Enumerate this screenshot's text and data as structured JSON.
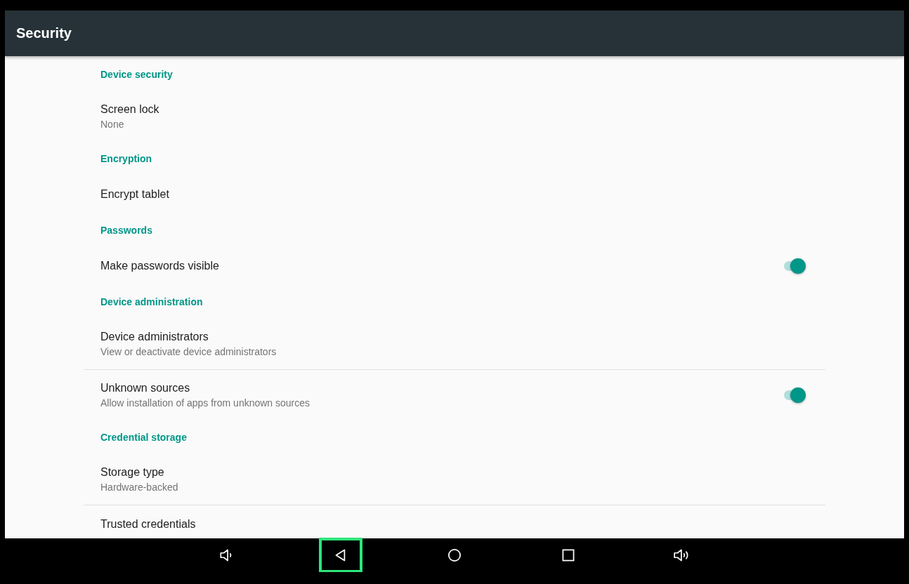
{
  "app_bar": {
    "title": "Security"
  },
  "sections": [
    {
      "header": "Device security",
      "items": [
        {
          "kind": "text",
          "title": "Screen lock",
          "summary": "None"
        }
      ]
    },
    {
      "header": "Encryption",
      "items": [
        {
          "kind": "text",
          "title": "Encrypt tablet"
        }
      ]
    },
    {
      "header": "Passwords",
      "items": [
        {
          "kind": "switch",
          "title": "Make passwords visible",
          "on": true
        }
      ]
    },
    {
      "header": "Device administration",
      "items": [
        {
          "kind": "text",
          "title": "Device administrators",
          "summary": "View or deactivate device administrators"
        },
        {
          "kind": "switch",
          "title": "Unknown sources",
          "summary": "Allow installation of apps from unknown sources",
          "on": true
        }
      ]
    },
    {
      "header": "Credential storage",
      "items": [
        {
          "kind": "text",
          "title": "Storage type",
          "summary": "Hardware-backed"
        },
        {
          "kind": "text",
          "title": "Trusted credentials"
        }
      ]
    }
  ],
  "nav_bar": [
    {
      "kind": "volume-down",
      "selected": false
    },
    {
      "kind": "back",
      "selected": true
    },
    {
      "kind": "home",
      "selected": false
    },
    {
      "kind": "recents",
      "selected": false
    },
    {
      "kind": "volume-up",
      "selected": false
    }
  ]
}
